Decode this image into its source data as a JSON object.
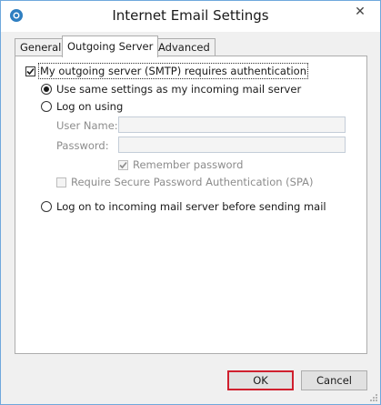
{
  "window": {
    "title": "Internet Email Settings",
    "close_glyph": "✕"
  },
  "tabs": [
    {
      "label": "General"
    },
    {
      "label": "Outgoing Server"
    },
    {
      "label": "Advanced"
    }
  ],
  "outgoing": {
    "requires_auth": {
      "label": "My outgoing server (SMTP) requires authentication",
      "checked": true
    },
    "use_same": {
      "label": "Use same settings as my incoming mail server",
      "selected": true
    },
    "log_on_using": {
      "label": "Log on using",
      "selected": false
    },
    "user_name": {
      "label": "User Name:",
      "value": ""
    },
    "password": {
      "label": "Password:",
      "value": ""
    },
    "remember_password": {
      "label": "Remember password",
      "checked": true
    },
    "spa": {
      "label": "Require Secure Password Authentication (SPA)",
      "checked": false
    },
    "log_on_incoming": {
      "label": "Log on to incoming mail server before sending mail",
      "selected": false
    }
  },
  "buttons": {
    "ok": "OK",
    "cancel": "Cancel"
  },
  "colors": {
    "default_button_border": "#d0202e",
    "window_border": "#6fa8dc"
  }
}
